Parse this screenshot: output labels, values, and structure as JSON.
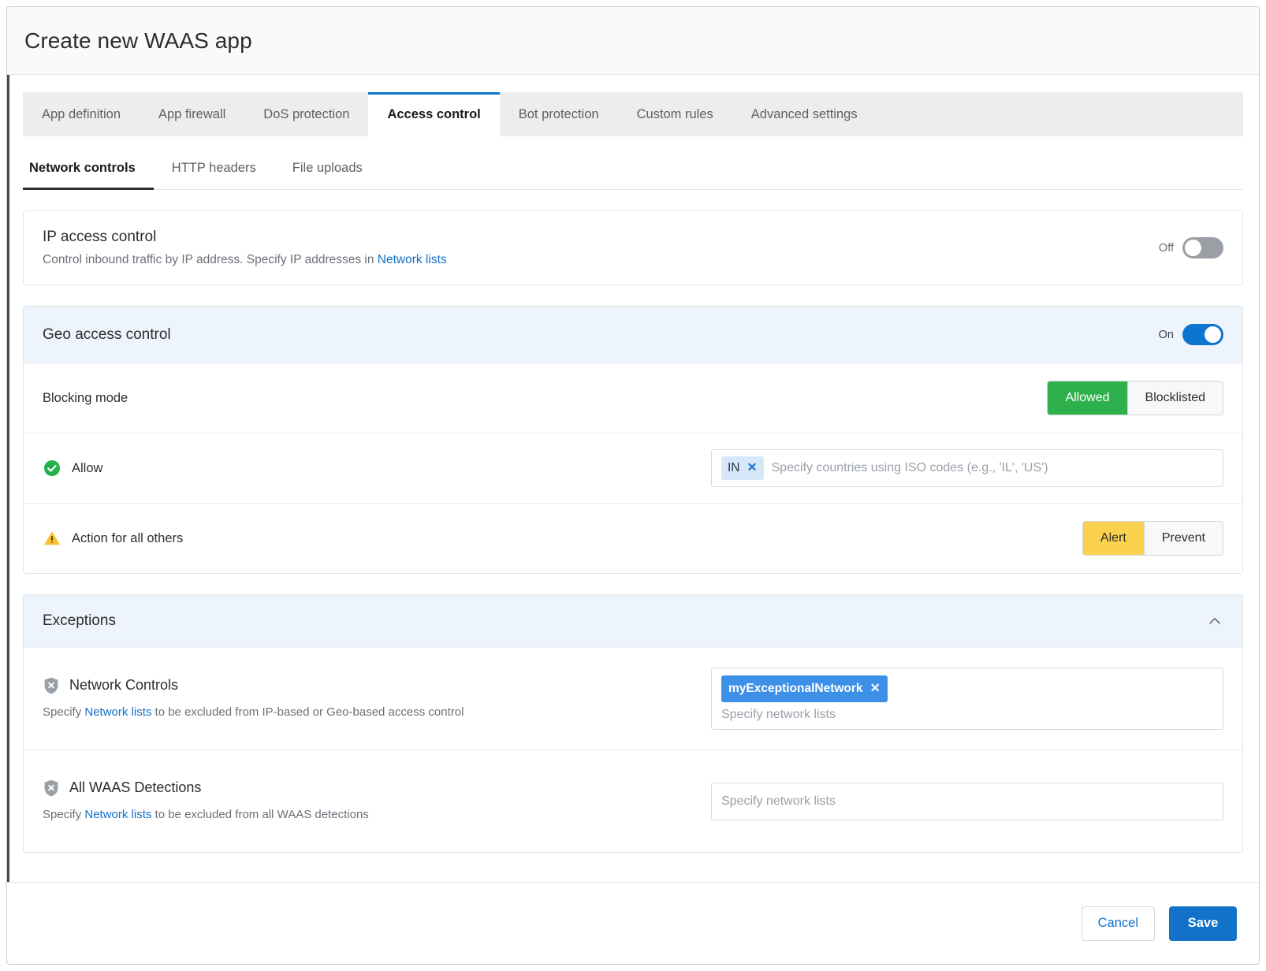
{
  "window": {
    "title": "Create new WAAS app"
  },
  "tabs": [
    {
      "label": "App definition",
      "active": false
    },
    {
      "label": "App firewall",
      "active": false
    },
    {
      "label": "DoS protection",
      "active": false
    },
    {
      "label": "Access control",
      "active": true
    },
    {
      "label": "Bot protection",
      "active": false
    },
    {
      "label": "Custom rules",
      "active": false
    },
    {
      "label": "Advanced settings",
      "active": false
    }
  ],
  "subtabs": [
    {
      "label": "Network controls",
      "active": true
    },
    {
      "label": "HTTP headers",
      "active": false
    },
    {
      "label": "File uploads",
      "active": false
    }
  ],
  "ip_access_control": {
    "title": "IP access control",
    "description_prefix": "Control inbound traffic by IP address. Specify IP addresses in ",
    "description_link": "Network lists",
    "toggle_label": "Off",
    "toggle_on": false
  },
  "geo_access_control": {
    "title": "Geo access control",
    "toggle_label": "On",
    "toggle_on": true,
    "blocking_mode": {
      "label": "Blocking mode",
      "options": [
        "Allowed",
        "Blocklisted"
      ],
      "selected": "Allowed"
    },
    "allow": {
      "label": "Allow",
      "icon": "check-circle-icon",
      "chips": [
        "IN"
      ],
      "placeholder": "Specify countries using ISO codes (e.g., 'IL', 'US')"
    },
    "action_for_all_others": {
      "label": "Action for all others",
      "icon": "warning-triangle-icon",
      "options": [
        "Alert",
        "Prevent"
      ],
      "selected": "Alert"
    }
  },
  "exceptions": {
    "title": "Exceptions",
    "collapse_icon": "chevron-up-icon",
    "rows": [
      {
        "title": "Network Controls",
        "icon": "shield-x-icon",
        "desc_prefix": "Specify ",
        "desc_link": "Network lists",
        "desc_suffix": " to be excluded from IP-based or Geo-based access control",
        "chips": [
          "myExceptionalNetwork"
        ],
        "placeholder": "Specify network lists"
      },
      {
        "title": "All WAAS Detections",
        "icon": "shield-x-icon",
        "desc_prefix": "Specify ",
        "desc_link": "Network lists",
        "desc_suffix": " to be excluded from all WAAS detections",
        "chips": [],
        "placeholder": "Specify network lists"
      }
    ]
  },
  "footer": {
    "cancel_label": "Cancel",
    "save_label": "Save"
  },
  "colors": {
    "accent_blue": "#1271c9",
    "tab_underline": "#0b75d0",
    "allowed_green": "#2eb04c",
    "alert_yellow": "#fbd24e",
    "chip_blue": "#3d90e8",
    "panel_tint": "#eef4fc"
  }
}
